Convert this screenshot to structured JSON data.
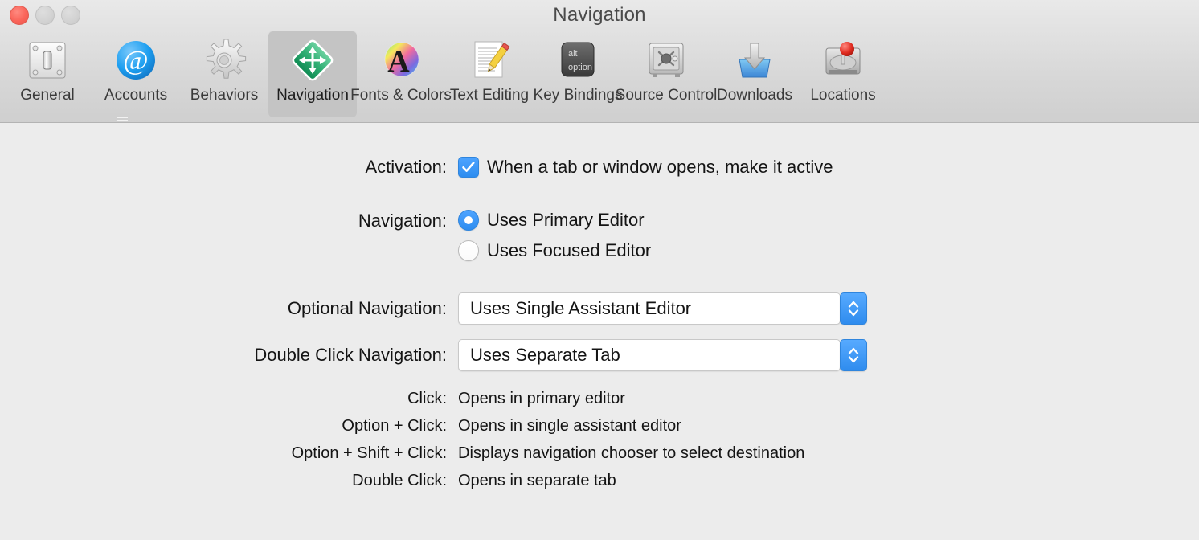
{
  "window": {
    "title": "Navigation",
    "traffic_lights": [
      {
        "name": "close",
        "color": "#fa6459",
        "enabled": true
      },
      {
        "name": "minimize",
        "color": "#d2d2d2",
        "enabled": false
      },
      {
        "name": "zoom",
        "color": "#d2d2d2",
        "enabled": false
      }
    ]
  },
  "toolbar": {
    "selected": "Navigation",
    "items": [
      {
        "label": "General",
        "icon": "light-switch-icon"
      },
      {
        "label": "Accounts",
        "icon": "at-sign-icon"
      },
      {
        "label": "Behaviors",
        "icon": "gear-icon"
      },
      {
        "label": "Navigation",
        "icon": "move-arrows-diamond-icon"
      },
      {
        "label": "Fonts & Colors",
        "icon": "color-wheel-letter-a-icon"
      },
      {
        "label": "Text Editing",
        "icon": "document-pencil-icon"
      },
      {
        "label": "Key Bindings",
        "icon": "alt-option-key-icon"
      },
      {
        "label": "Source Control",
        "icon": "safe-vault-icon"
      },
      {
        "label": "Downloads",
        "icon": "download-arrow-icon"
      },
      {
        "label": "Locations",
        "icon": "hard-drive-pin-icon"
      }
    ]
  },
  "form": {
    "activation": {
      "label": "Activation:",
      "checkbox_label": "When a tab or window opens, make it active",
      "checked": true
    },
    "navigation": {
      "label": "Navigation:",
      "options": [
        {
          "label": "Uses Primary Editor",
          "selected": true
        },
        {
          "label": "Uses Focused Editor",
          "selected": false
        }
      ]
    },
    "optional_navigation": {
      "label": "Optional Navigation:",
      "value": "Uses Single Assistant Editor"
    },
    "double_click_navigation": {
      "label": "Double Click Navigation:",
      "value": "Uses Separate Tab"
    }
  },
  "info": {
    "rows": [
      {
        "key": "Click:",
        "value": "Opens in primary editor"
      },
      {
        "key": "Option + Click:",
        "value": "Opens in single assistant editor"
      },
      {
        "key": "Option + Shift + Click:",
        "value": "Displays navigation chooser to select destination"
      },
      {
        "key": "Double Click:",
        "value": "Opens in separate tab"
      }
    ]
  },
  "colors": {
    "accent_blue": "#2d8df0",
    "window_bg": "#ececec",
    "toolbar_bg": "#d8d8d8",
    "selected_tab_bg": "#c4c4c4",
    "close_red": "#fa6459",
    "nav_icon_green": "#2aa567"
  }
}
